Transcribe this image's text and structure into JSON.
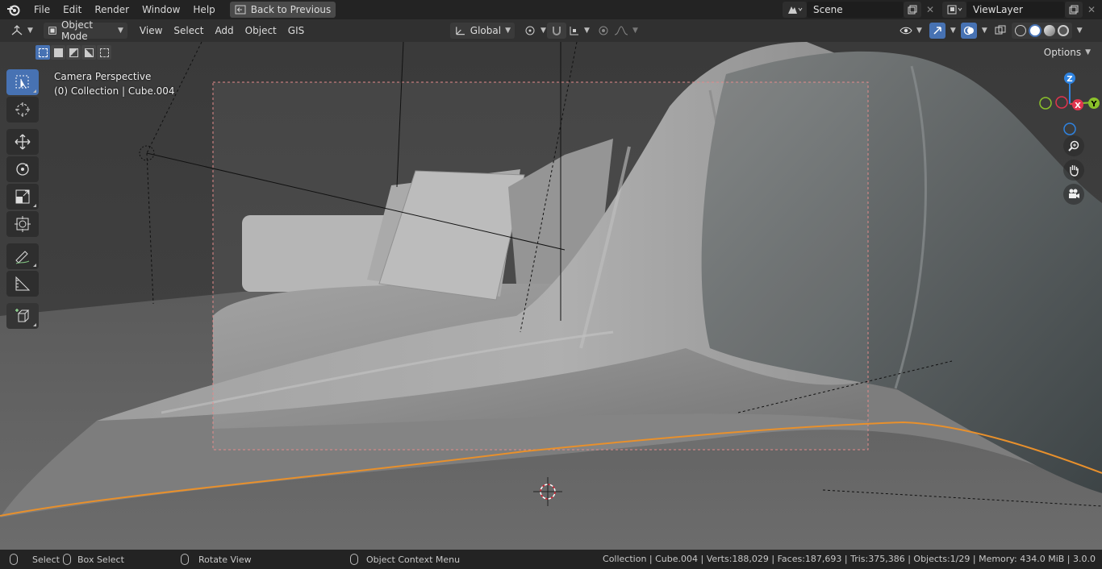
{
  "menubar": {
    "items": [
      "File",
      "Edit",
      "Render",
      "Window",
      "Help"
    ],
    "back_button": "Back to Previous",
    "scene": "Scene",
    "view_layer": "ViewLayer"
  },
  "header": {
    "mode": "Object Mode",
    "menus": [
      "View",
      "Select",
      "Add",
      "Object",
      "GIS"
    ],
    "transform_orientation": "Global",
    "options": "Options"
  },
  "viewport": {
    "info_line1": "Camera Perspective",
    "info_line2": "(0) Collection | Cube.004",
    "tools": [
      "select-box",
      "cursor",
      "move",
      "rotate",
      "scale",
      "transform",
      "annotate",
      "measure",
      "add-cube"
    ],
    "gizmo": {
      "z": "Z",
      "x": "X",
      "y": "Y"
    }
  },
  "statusbar": {
    "select": "Select",
    "box_select": "Box Select",
    "rotate_view": "Rotate View",
    "context_menu": "Object Context Menu",
    "stats": "Collection | Cube.004 | Verts:188,029 | Faces:187,693 | Tris:375,386 | Objects:1/29 | Memory: 434.0 MiB | 3.0.0"
  },
  "colors": {
    "accent": "#4772b3",
    "selection_outline": "#e8902c",
    "gizmo_x": "#e0344f",
    "gizmo_y": "#8bc12a",
    "gizmo_z": "#2f83e0"
  }
}
